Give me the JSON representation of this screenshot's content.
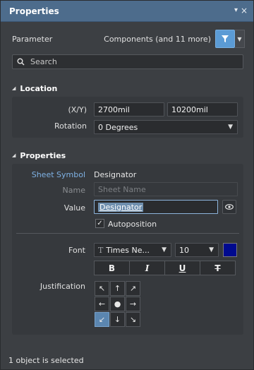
{
  "panel": {
    "title": "Properties",
    "menu_glyph": "▾",
    "close_glyph": "×"
  },
  "parameter": {
    "label": "Parameter",
    "filter_summary": "Components (and 11 more)"
  },
  "search": {
    "placeholder": "Search"
  },
  "location": {
    "heading": "Location",
    "xy_label": "(X/Y)",
    "x_value": "2700mil",
    "y_value": "10200mil",
    "rotation_label": "Rotation",
    "rotation_value": "0 Degrees"
  },
  "properties": {
    "heading": "Properties",
    "sheet_symbol_label": "Sheet Symbol",
    "sheet_symbol_value": "Designator",
    "name_label": "Name",
    "name_placeholder": "Sheet Name",
    "value_label": "Value",
    "value_text": "Designator",
    "autoposition_label": "Autoposition",
    "autoposition_checked": true,
    "font_label": "Font",
    "font_family": "Times Ne...",
    "font_size": "10",
    "font_color": "#000a8f",
    "style_buttons": [
      "B",
      "I",
      "U",
      "T"
    ],
    "justification_label": "Justification",
    "justification_arrows": [
      "↖",
      "↑",
      "↗",
      "←",
      "●",
      "→",
      "↙",
      "↓",
      "↘"
    ],
    "justification_selected": "bottom-left"
  },
  "status": {
    "text": "1 object is selected"
  },
  "colors": {
    "titlebar": "#4d6c8c",
    "accent": "#5b9bd5",
    "link": "#7fb2e5"
  }
}
